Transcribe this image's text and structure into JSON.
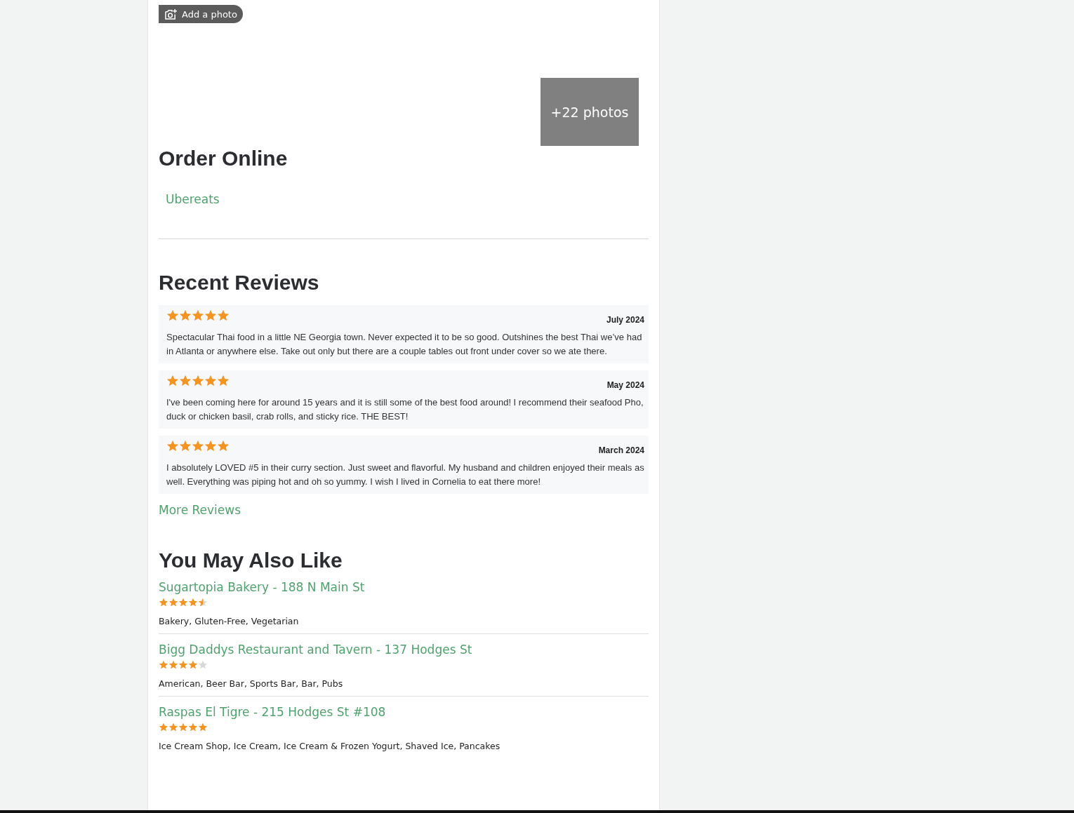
{
  "add_photo_button": "Add a photo",
  "photos_more": "+22 photos",
  "order_online": {
    "heading": "Order Online",
    "links": [
      "Ubereats"
    ]
  },
  "recent_reviews": {
    "heading": "Recent Reviews",
    "reviews": [
      {
        "stars": 5,
        "date": "July 2024",
        "text": "Spectacular Thai food in a little NE Georgia town. Never expected it to be so good. Outshines the best Thai we’ve had in Atlanta or anywhere else. Take out only but there are a couple tables out front under cover so we ate there."
      },
      {
        "stars": 5,
        "date": "May 2024",
        "text": "I've been coming here for around 15 years and it is still some of the best food around! I recommend their seafood Pho, duck or chicken basil, crab rolls, and sticky rice. THE BEST!"
      },
      {
        "stars": 5,
        "date": "March 2024",
        "text": "I absolutely LOVED #5 in their curry section. Just sweet and flavorful. My husband and children enjoyed their meals as well. Everything was piping hot and oh so yummy. I wish I lived in Cornelia to eat there more!"
      }
    ],
    "more_link": "More Reviews"
  },
  "also_like": {
    "heading": "You May Also Like",
    "places": [
      {
        "name": "Sugartopia Bakery - 188 N Main St",
        "stars": 4.5,
        "categories": "Bakery, Gluten-Free, Vegetarian"
      },
      {
        "name": "Bigg Daddys Restaurant and Tavern - 137 Hodges St",
        "stars": 4,
        "categories": "American, Beer Bar, Sports Bar, Bar, Pubs"
      },
      {
        "name": "Raspas El Tigre - 215 Hodges St #108",
        "stars": 5,
        "categories": "Ice Cream Shop, Ice Cream, Ice Cream & Frozen Yogurt, Shaved Ice, Pancakes"
      }
    ]
  }
}
